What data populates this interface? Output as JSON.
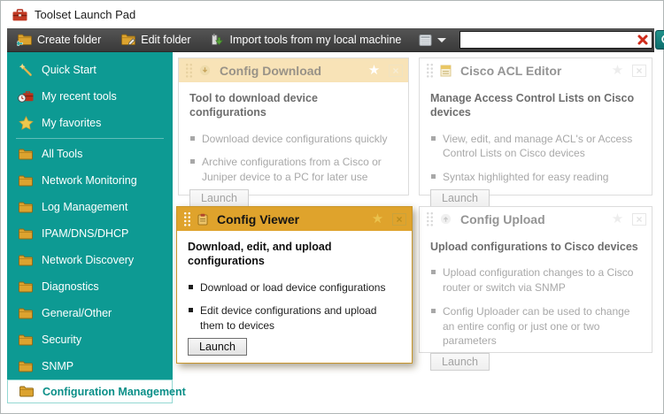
{
  "window": {
    "title": "Toolset Launch Pad"
  },
  "toolbar": {
    "buttons": [
      {
        "label": "Create folder"
      },
      {
        "label": "Edit folder"
      },
      {
        "label": "Import tools from my local machine"
      }
    ],
    "search_value": ""
  },
  "icons": {
    "star_glyph": "★",
    "close_glyph": "×"
  },
  "sidebar": {
    "items": [
      {
        "label": "Quick Start"
      },
      {
        "label": "My recent tools"
      },
      {
        "label": "My favorites"
      },
      {
        "label": "All Tools"
      },
      {
        "label": "Network Monitoring"
      },
      {
        "label": "Log Management"
      },
      {
        "label": "IPAM/DNS/DHCP"
      },
      {
        "label": "Network Discovery"
      },
      {
        "label": "Diagnostics"
      },
      {
        "label": "General/Other"
      },
      {
        "label": "Security"
      },
      {
        "label": "SNMP"
      },
      {
        "label": "Configuration Management"
      }
    ],
    "selected_item": "Configuration Management"
  },
  "cards": [
    {
      "title": "Config Download",
      "heading": "Tool to download device configurations",
      "bullets": [
        "Download device configurations quickly",
        "Archive configurations from a Cisco or Juniper device to a PC for later use"
      ],
      "launch_label": "Launch",
      "state": "favorite-highlighted"
    },
    {
      "title": "Cisco ACL Editor",
      "heading": "Manage Access Control Lists on Cisco devices",
      "bullets": [
        "View, edit, and manage ACL's or Access Control Lists on Cisco devices",
        "Syntax highlighted for easy reading"
      ],
      "launch_label": "Launch",
      "state": "normal"
    },
    {
      "title": "Config Viewer",
      "heading": "Download, edit, and upload configurations",
      "bullets": [
        "Download or load device configurations",
        "Edit device configurations and upload them to devices"
      ],
      "launch_label": "Launch",
      "state": "active"
    },
    {
      "title": "Config Upload",
      "heading": "Upload configurations to Cisco devices",
      "bullets": [
        "Upload configuration changes to a Cisco router or switch via SNMP",
        "Config Uploader can be used to change an entire config or just one or two parameters"
      ],
      "launch_label": "Launch",
      "state": "normal"
    }
  ],
  "colors": {
    "sidebar_teal": "#0d9a93",
    "active_card_header": "#dfa32c",
    "highlighted_card_header": "#f8e3b7",
    "toolbar_dark": "#3d3d3d",
    "search_button_teal": "#12807c",
    "clear_red": "#cf2b1b",
    "folder_gold": "#dca32f"
  }
}
